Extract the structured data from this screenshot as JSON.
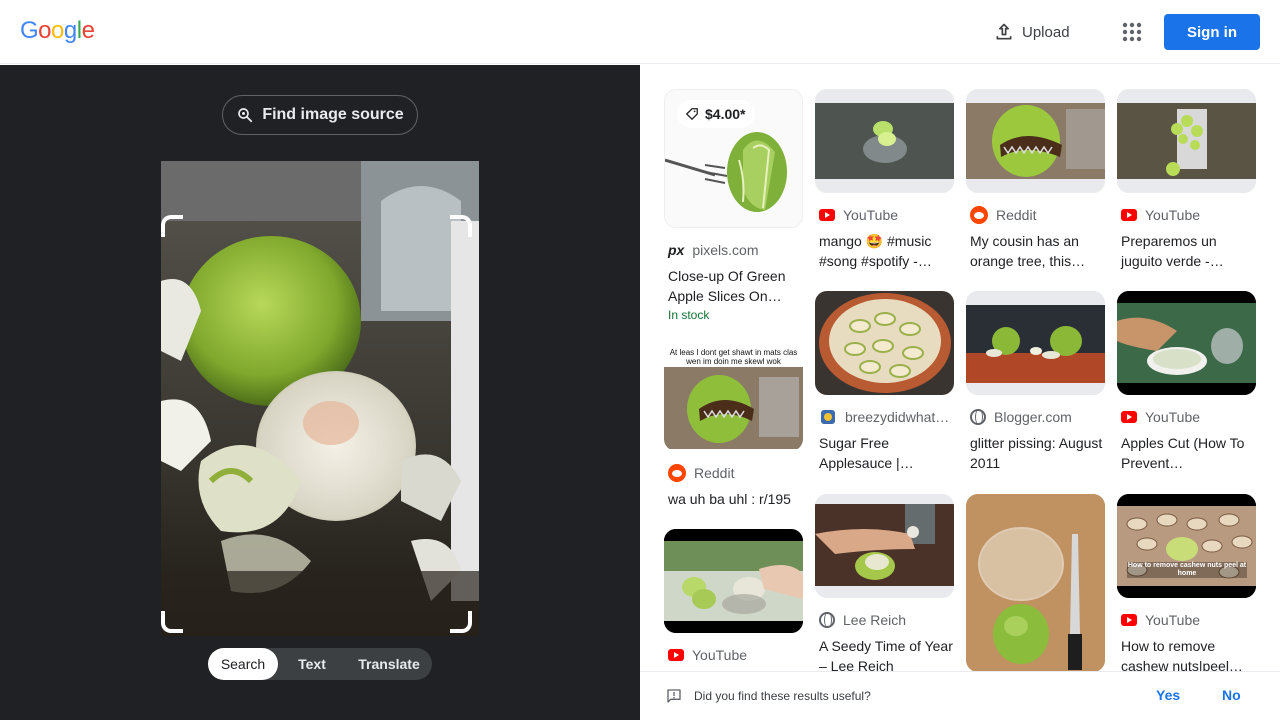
{
  "header": {
    "logo_letters": [
      {
        "ch": "G",
        "color": "#4285F4"
      },
      {
        "ch": "o",
        "color": "#EA4335"
      },
      {
        "ch": "o",
        "color": "#FBBC05"
      },
      {
        "ch": "g",
        "color": "#4285F4"
      },
      {
        "ch": "l",
        "color": "#34A853"
      },
      {
        "ch": "e",
        "color": "#EA4335"
      }
    ],
    "upload_label": "Upload",
    "sign_in_label": "Sign in"
  },
  "lens": {
    "find_source_label": "Find image source",
    "tabs": [
      {
        "label": "Search",
        "active": true
      },
      {
        "label": "Text",
        "active": false
      },
      {
        "label": "Translate",
        "active": false
      }
    ]
  },
  "results": [
    {
      "source": "pixels.com",
      "source_icon": "pexels-icon",
      "title": "Close-up Of Green Apple Slices On…",
      "price": "$4.00*",
      "stock": "In stock"
    },
    {
      "source": "Reddit",
      "source_icon": "reddit-icon",
      "title": "wa uh ba uhl : r/195",
      "caption": "At leas I dont get shawt in mats clas wen im doin me skewl wok"
    },
    {
      "source": "YouTube",
      "source_icon": "youtube-icon",
      "title": ""
    },
    {
      "source": "YouTube",
      "source_icon": "youtube-icon",
      "title": "mango 🤩 #music #song #spotify -…"
    },
    {
      "source": "breezydidwhat…",
      "source_icon": "blog-icon",
      "title": "Sugar Free Applesauce |…"
    },
    {
      "source": "Lee Reich",
      "source_icon": "globe-icon",
      "title": "A Seedy Time of Year – Lee Reich"
    },
    {
      "source": "Reddit",
      "source_icon": "reddit-icon",
      "title": "My cousin has an orange tree, this…"
    },
    {
      "source": "Blogger.com",
      "source_icon": "globe-icon",
      "title": "glitter pissing: August 2011"
    },
    {
      "source": "YouTube",
      "source_icon": "youtube-icon",
      "title": "Preparemos un juguito verde -…"
    },
    {
      "source": "YouTube",
      "source_icon": "youtube-icon",
      "title": "Apples Cut (How To Prevent…"
    },
    {
      "source": "YouTube",
      "source_icon": "youtube-icon",
      "title": "How to remove cashew nuts|peel…",
      "caption": "How to remove cashew nuts peel at home"
    }
  ],
  "feedback": {
    "question": "Did you find these results useful?",
    "yes_label": "Yes",
    "no_label": "No"
  },
  "colors": {
    "accent": "#1a73e8",
    "dark_pane": "#202124",
    "stock_green": "#137333",
    "youtube_red": "#ff0000",
    "reddit_orange": "#ff4500"
  }
}
